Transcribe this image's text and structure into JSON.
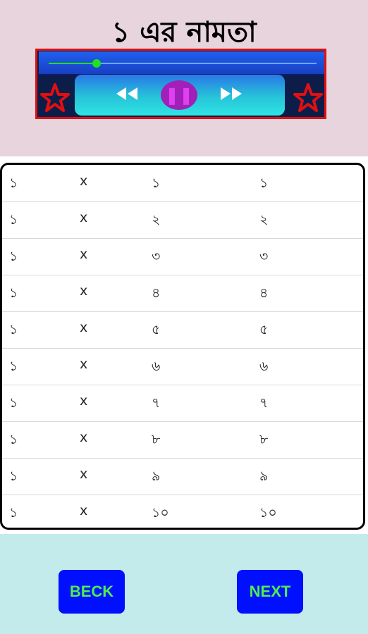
{
  "title": "১ এর নামতা",
  "player": {
    "progress": 0.18,
    "prev_icon": "rewind-icon",
    "pause_icon": "pause-icon",
    "next_icon": "fast-forward-icon",
    "star_icon": "star-icon",
    "colors": {
      "frame": "#e01010",
      "pause": "#a020b8",
      "seek": "#20e020"
    }
  },
  "table": {
    "rows": [
      [
        "১",
        "x",
        "১",
        "১"
      ],
      [
        "১",
        "x",
        "২",
        "২"
      ],
      [
        "১",
        "x",
        "৩",
        "৩"
      ],
      [
        "১",
        "x",
        "৪",
        "৪"
      ],
      [
        "১",
        "x",
        "৫",
        "৫"
      ],
      [
        "১",
        "x",
        "৬",
        "৬"
      ],
      [
        "১",
        "x",
        "৭",
        "৭"
      ],
      [
        "১",
        "x",
        "৮",
        "৮"
      ],
      [
        "১",
        "x",
        "৯",
        "৯"
      ],
      [
        "১",
        "x",
        "১০",
        "১০"
      ]
    ]
  },
  "footer": {
    "back_label": "BECK",
    "next_label": "NEXT"
  }
}
